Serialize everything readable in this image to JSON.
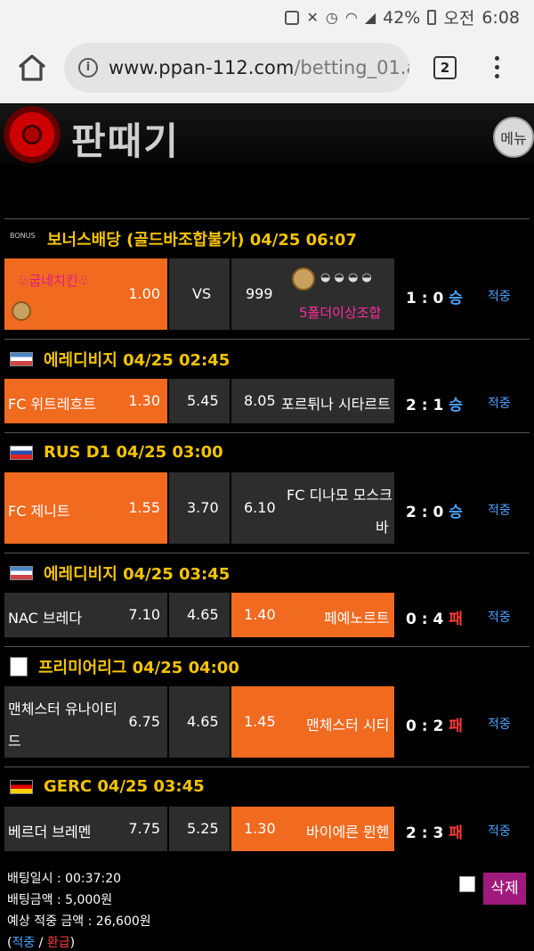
{
  "status_bar": {
    "battery": "42%",
    "ampm": "오전",
    "time": "6:08"
  },
  "browser": {
    "url_main": "www.ppan-112.com",
    "url_rest": "/betting_01.as",
    "tab_count": "2"
  },
  "site": {
    "logo_text": "판때기",
    "menu_label": "메뉴"
  },
  "sections": [
    {
      "league": "보너스배당 (골드바조합불가) 04/25 06:07",
      "icon": "bonus-icon",
      "home": "♧굽네치킨♧",
      "home_odds": "1.00",
      "draw": "VS",
      "away_odds": "999",
      "away": "5폴더이상조합",
      "score": "1 : 0",
      "result": "승",
      "hit": "적중"
    },
    {
      "league": "에레디비지 04/25 02:45",
      "icon": "netherlands-league-icon",
      "home": "FC 위트레흐트",
      "home_odds": "1.30",
      "draw": "5.45",
      "away_odds": "8.05",
      "away": "포르튀나 시타르트",
      "score": "2 : 1",
      "result": "승",
      "hit": "적중"
    },
    {
      "league": "RUS D1 04/25 03:00",
      "icon": "russia-flag-icon",
      "home": "FC 제니트",
      "home_odds": "1.55",
      "draw": "3.70",
      "away_odds": "6.10",
      "away_line1": "FC 디나모 모스크",
      "away_line2": "바",
      "score": "2 : 0",
      "result": "승",
      "hit": "적중"
    },
    {
      "league": "에레디비지 04/25 03:45",
      "icon": "netherlands-league-icon",
      "home": "NAC 브레다",
      "home_odds": "7.10",
      "draw": "4.65",
      "away_odds": "1.40",
      "away": "페예노르트",
      "score": "0 : 4",
      "result": "패",
      "hit": "적중"
    },
    {
      "league": "프리미어리그 04/25 04:00",
      "icon": "premier-league-icon",
      "home_line1": "맨체스터 유나이티",
      "home_line2": "드",
      "home_odds": "6.75",
      "draw": "4.65",
      "away_odds": "1.45",
      "away": "맨체스터 시티",
      "score": "0 : 2",
      "result": "패",
      "hit": "적중"
    },
    {
      "league": "GERC 04/25 03:45",
      "icon": "germany-flag-icon",
      "home": "베르더 브레멘",
      "home_odds": "7.75",
      "draw": "5.25",
      "away_odds": "1.30",
      "away": "바이에른 뮌헨",
      "score": "2 : 3",
      "result": "패",
      "hit": "적중"
    }
  ],
  "bet_info": {
    "date_label": "배팅일시 : 00:37:20",
    "amount_label": "배팅금액 : 5,000원",
    "expected_label": "예상 적중 금액 : 26,600원",
    "hit_word": "적중",
    "refund_word": "환급",
    "delete_label": "삭제"
  },
  "colors": {
    "accent": "#f06a1f",
    "league": "#f5c400",
    "win": "#4aa3ff",
    "lose": "#ff3b3b",
    "delete": "#a01a7d"
  }
}
